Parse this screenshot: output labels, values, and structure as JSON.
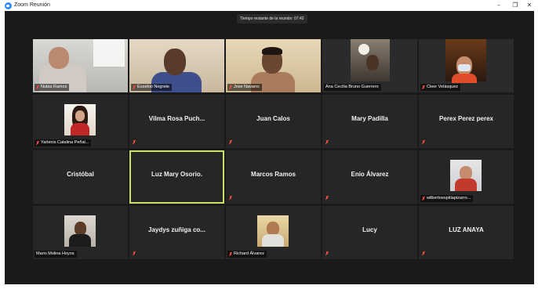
{
  "window": {
    "title": "Zoom Reunión",
    "minimize": "–",
    "maximize": "❐",
    "close": "✕"
  },
  "timer": "Tiempo restante de la reunión: 07:42",
  "accent_color": "#c8e26a",
  "muted_color": "#e84c3d",
  "participants": [
    {
      "name": "Nubia Ramos",
      "display": "video",
      "muted": true
    },
    {
      "name": "Eusebio Negrete",
      "display": "video",
      "muted": true
    },
    {
      "name": "Jose Navarro",
      "display": "video",
      "muted": true
    },
    {
      "name": "Ana Cecilia Bruno Guerrero",
      "display": "video",
      "muted": false
    },
    {
      "name": "Cleer Velásquez",
      "display": "video",
      "muted": true
    },
    {
      "name": "Yarlenis Catalina Peñal...",
      "display": "photo",
      "muted": true
    },
    {
      "name": "Vilma Rosa Puch...",
      "display": "name",
      "muted": true
    },
    {
      "name": "Juan Calos",
      "display": "name",
      "muted": true
    },
    {
      "name": "Mary Padilla",
      "display": "name",
      "muted": true
    },
    {
      "name": "Perex Perez perex",
      "display": "name",
      "muted": true
    },
    {
      "name": "Cristóbal",
      "display": "name",
      "muted": false
    },
    {
      "name": "Luz Mary Osorio.",
      "display": "name",
      "muted": false,
      "active_speaker": true
    },
    {
      "name": "Marcos Ramos",
      "display": "name",
      "muted": true
    },
    {
      "name": "Enio Álvarez",
      "display": "name",
      "muted": true
    },
    {
      "name": "wilbertoespitiapizarro...",
      "display": "photo",
      "muted": true
    },
    {
      "name": "Mario Molina Hoyos",
      "display": "photo",
      "muted": false
    },
    {
      "name": "Jaydys zuñiga co...",
      "display": "name",
      "muted": true
    },
    {
      "name": "Richard Álvarez",
      "display": "photo",
      "muted": true
    },
    {
      "name": "Lucy",
      "display": "name",
      "muted": true
    },
    {
      "name": "LUZ ANAYA",
      "display": "name",
      "muted": true
    }
  ]
}
